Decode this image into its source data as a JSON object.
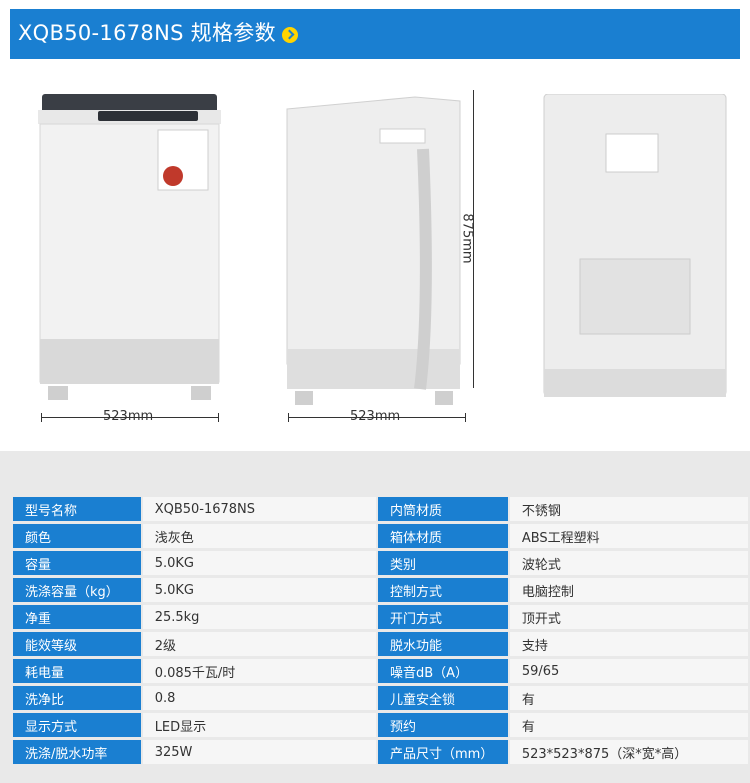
{
  "header": {
    "title": "XQB50-1678NS 规格参数",
    "arrow_icon": "chevron-right-icon"
  },
  "colors": {
    "brand_blue": "#1a7fd1",
    "accent_yellow": "#ffd400"
  },
  "dimensions": {
    "front_width": "523mm",
    "side_width": "523mm",
    "height": "875mm"
  },
  "specs": [
    {
      "k1": "型号名称",
      "v1": "XQB50-1678NS",
      "k2": "内筒材质",
      "v2": "不锈钢"
    },
    {
      "k1": "颜色",
      "v1": "浅灰色",
      "k2": "箱体材质",
      "v2": "ABS工程塑料"
    },
    {
      "k1": "容量",
      "v1": "5.0KG",
      "k2": "类别",
      "v2": "波轮式"
    },
    {
      "k1": "洗涤容量（kg）",
      "v1": "5.0KG",
      "k2": "控制方式",
      "v2": "电脑控制"
    },
    {
      "k1": "净重",
      "v1": "25.5kg",
      "k2": "开门方式",
      "v2": "顶开式"
    },
    {
      "k1": "能效等级",
      "v1": "2级",
      "k2": "脱水功能",
      "v2": "支持"
    },
    {
      "k1": "耗电量",
      "v1": "0.085千瓦/时",
      "k2": "噪音dB（A）",
      "v2": "59/65"
    },
    {
      "k1": "洗净比",
      "v1": "0.8",
      "k2": "儿童安全锁",
      "v2": "有"
    },
    {
      "k1": "显示方式",
      "v1": "LED显示",
      "k2": "预约",
      "v2": "有"
    },
    {
      "k1": "洗涤/脱水功率",
      "v1": "325W",
      "k2": "产品尺寸（mm）",
      "v2": "523*523*875（深*宽*高）"
    }
  ]
}
